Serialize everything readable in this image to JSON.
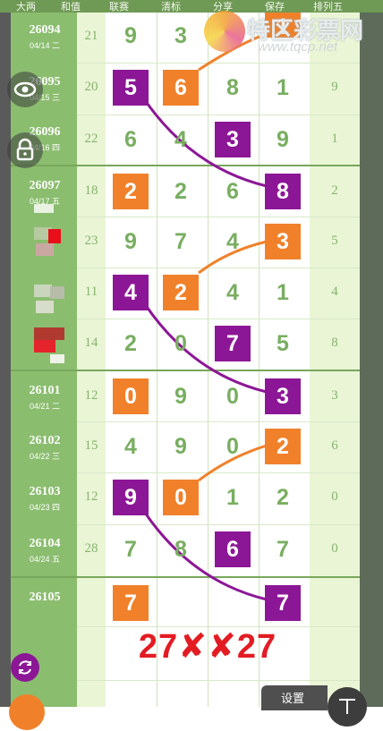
{
  "header": {
    "columns": [
      "大两",
      "和值",
      "联赛",
      "清标",
      "分享",
      "保存",
      "排列五"
    ]
  },
  "logo": {
    "text": "特区彩票网",
    "url": "www.tqcp.net"
  },
  "rows": [
    {
      "issue": "26094",
      "date": "04/14 二",
      "sum": "21",
      "d": [
        "9",
        "3",
        "",
        ""
      ],
      "last": ""
    },
    {
      "issue": "26095",
      "date": "04/15 三",
      "sum": "20",
      "d": [
        "5",
        "6",
        "8",
        "1"
      ],
      "last": "9"
    },
    {
      "issue": "26096",
      "date": "04/16 四",
      "sum": "22",
      "d": [
        "6",
        "4",
        "3",
        "9"
      ],
      "last": "1"
    },
    {
      "issue": "26097",
      "date": "04/17 五",
      "sum": "18",
      "d": [
        "2",
        "2",
        "6",
        "8"
      ],
      "last": "2"
    },
    {
      "issue": "",
      "date": "",
      "sum": "23",
      "d": [
        "9",
        "7",
        "4",
        "3"
      ],
      "last": "5"
    },
    {
      "issue": "",
      "date": "",
      "sum": "11",
      "d": [
        "4",
        "2",
        "4",
        "1"
      ],
      "last": "4"
    },
    {
      "issue": "",
      "date": "",
      "sum": "14",
      "d": [
        "2",
        "0",
        "7",
        "5"
      ],
      "last": "8"
    },
    {
      "issue": "26101",
      "date": "04/21 二",
      "sum": "12",
      "d": [
        "0",
        "9",
        "0",
        "3"
      ],
      "last": "3"
    },
    {
      "issue": "26102",
      "date": "04/22 三",
      "sum": "15",
      "d": [
        "4",
        "9",
        "0",
        "2"
      ],
      "last": "6"
    },
    {
      "issue": "26103",
      "date": "04/23 四",
      "sum": "12",
      "d": [
        "9",
        "0",
        "1",
        "2"
      ],
      "last": "0"
    },
    {
      "issue": "26104",
      "date": "04/24 五",
      "sum": "28",
      "d": [
        "7",
        "8",
        "6",
        "7"
      ],
      "last": "0"
    },
    {
      "issue": "26105",
      "date": "",
      "sum": "",
      "d": [
        "7",
        "",
        "",
        "7"
      ],
      "last": ""
    }
  ],
  "top_digit_hidden": "1",
  "result": "27✘✘27",
  "settings_label": "设置",
  "colors": {
    "orange": "#f0812a",
    "purple": "#8c1796",
    "green": "#8bbd6f",
    "red": "#e31c23"
  }
}
